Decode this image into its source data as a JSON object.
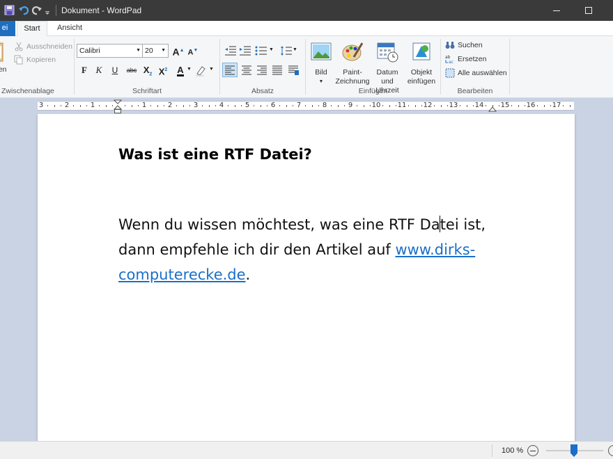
{
  "window": {
    "title": "Dokument - WordPad",
    "minimize_symbol": "—",
    "maximize_symbol": "☐"
  },
  "tabs": [
    {
      "label": "ei",
      "active": false
    },
    {
      "label": "Start",
      "active": true
    },
    {
      "label": "Ansicht",
      "active": false
    }
  ],
  "ribbon": {
    "clipboard": {
      "paste_label": "gen",
      "cut_label": "Ausschneiden",
      "copy_label": "Kopieren",
      "group_label": "Zwischenablage"
    },
    "font": {
      "font_name": "Calibri",
      "font_size": "20",
      "grow_label": "A",
      "shrink_label": "A",
      "bold": "F",
      "italic": "K",
      "underline": "U",
      "strike": "abc",
      "subscript": "X",
      "superscript": "X",
      "color_label": "A",
      "group_label": "Schriftart"
    },
    "paragraph": {
      "group_label": "Absatz"
    },
    "insert": {
      "picture_label": "Bild",
      "paint_label_1": "Paint-",
      "paint_label_2": "Zeichnung",
      "datetime_label_1": "Datum und",
      "datetime_label_2": "Uhrzeit",
      "object_label_1": "Objekt",
      "object_label_2": "einfügen",
      "group_label": "Einfügen"
    },
    "edit": {
      "find_label": "Suchen",
      "replace_label": "Ersetzen",
      "select_all_label": "Alle auswählen",
      "group_label": "Bearbeiten"
    }
  },
  "ruler": {
    "numbers": [
      "3",
      "2",
      "1",
      "1",
      "2",
      "3",
      "4",
      "5",
      "6",
      "7",
      "8",
      "9",
      "10",
      "11",
      "12",
      "13",
      "14",
      "15",
      "16",
      "17"
    ]
  },
  "document": {
    "heading": "Was ist eine RTF Datei?",
    "para_before_caret": "Wenn du wissen möchtest, was eine RTF Da",
    "para_after_caret": "tei ist, dann empfehle ich dir den Artikel auf ",
    "link_text": "www.dirks-computerecke.de",
    "para_end": "."
  },
  "statusbar": {
    "zoom": "100 %",
    "zoom_level_percent": 100
  },
  "colors": {
    "accent": "#1e6fc0",
    "titlebar": "#3a3a3a",
    "link": "#1a6fc8",
    "workspace": "#c9d3e4"
  }
}
